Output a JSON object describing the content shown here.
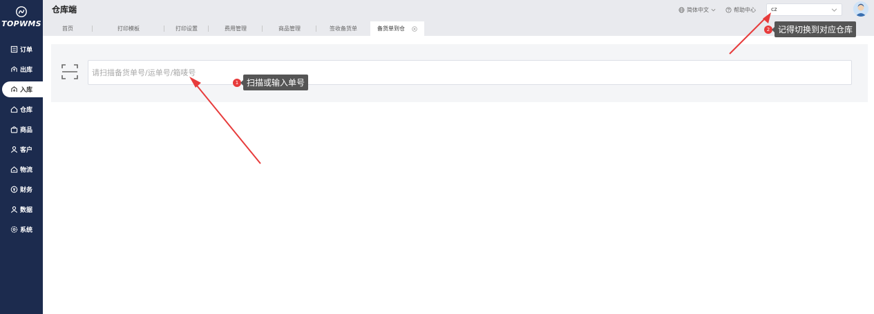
{
  "brand": {
    "logo_text": "TOPWMS"
  },
  "sidebar": {
    "items": [
      {
        "label": "订单",
        "icon": "list-icon",
        "active": false
      },
      {
        "label": "出库",
        "icon": "export-icon",
        "active": false
      },
      {
        "label": "入库",
        "icon": "import-icon",
        "active": true
      },
      {
        "label": "仓库",
        "icon": "home-icon",
        "active": false
      },
      {
        "label": "商品",
        "icon": "bag-icon",
        "active": false
      },
      {
        "label": "客户",
        "icon": "users-icon",
        "active": false
      },
      {
        "label": "物流",
        "icon": "truck-icon",
        "active": false
      },
      {
        "label": "财务",
        "icon": "finance-icon",
        "active": false
      },
      {
        "label": "数据",
        "icon": "data-icon",
        "active": false
      },
      {
        "label": "系统",
        "icon": "gear-icon",
        "active": false
      }
    ]
  },
  "header": {
    "title": "仓库端",
    "language": "简体中文",
    "help": "帮助中心",
    "warehouse_value": "cz"
  },
  "tabs": [
    {
      "label": "首页"
    },
    {
      "label": "打印模板"
    },
    {
      "label": "打印设置"
    },
    {
      "label": "费用管理"
    },
    {
      "label": "商品管理"
    },
    {
      "label": "签收备货单"
    },
    {
      "label": "备货单到仓"
    }
  ],
  "main": {
    "scan_placeholder": "请扫描备货单号/运单号/箱唛号",
    "scan_value": ""
  },
  "annotations": {
    "tip1_num": "1",
    "tip1_text": "扫描或输入单号",
    "tip2_num": "2",
    "tip2_text": "记得切换到对应仓库",
    "arrow_color": "#e73b3b"
  },
  "colors": {
    "sidebar_bg": "#1c2b4e",
    "header_bg": "#e9eaee",
    "panel_bg": "#f4f5f7",
    "badge_red": "#e73b3b"
  }
}
